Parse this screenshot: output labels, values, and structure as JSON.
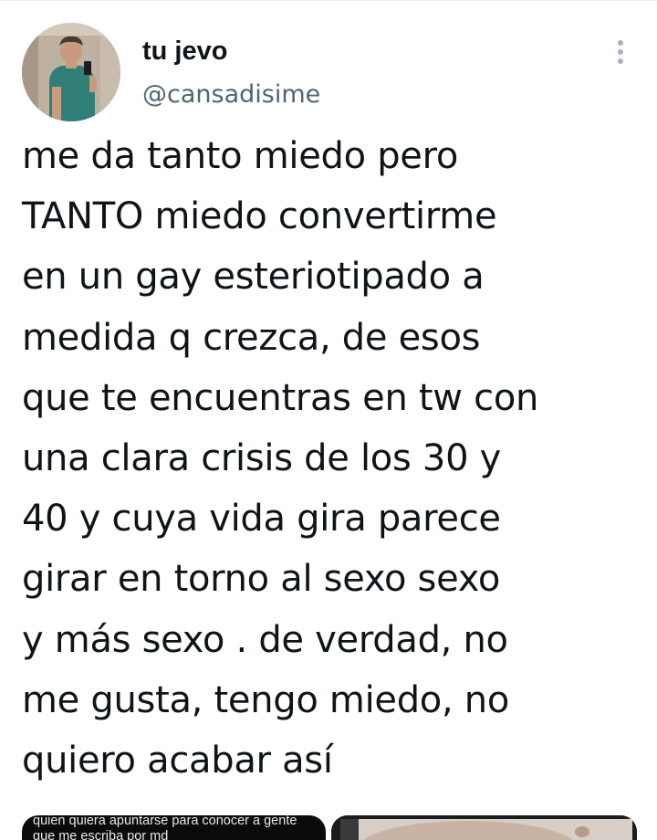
{
  "author": {
    "display_name": "tu jevo",
    "handle": "@cansadisime"
  },
  "tweet": {
    "lines": [
      "me da tanto miedo pero",
      "TANTO miedo convertirme",
      "en un gay esteriotipado a",
      "medida q crezca, de esos",
      "que te encuentras en tw con",
      "una clara crisis de los 30 y",
      "40 y cuya vida gira parece",
      "girar en torno al sexo sexo",
      "y más sexo . de verdad, no",
      "me gusta, tengo miedo, no",
      "quiero acabar así"
    ]
  },
  "media": [
    {
      "caption_lines": [
        "quien quiera apuntarse para conocer a gente",
        "que me escriba por md"
      ]
    },
    {
      "caption_lines": []
    }
  ],
  "icons": {
    "more": "more-vertical-icon"
  },
  "colors": {
    "text": "#0f1419",
    "secondary_text": "#536471",
    "icon": "#a8b2bb",
    "background": "#ffffff"
  }
}
